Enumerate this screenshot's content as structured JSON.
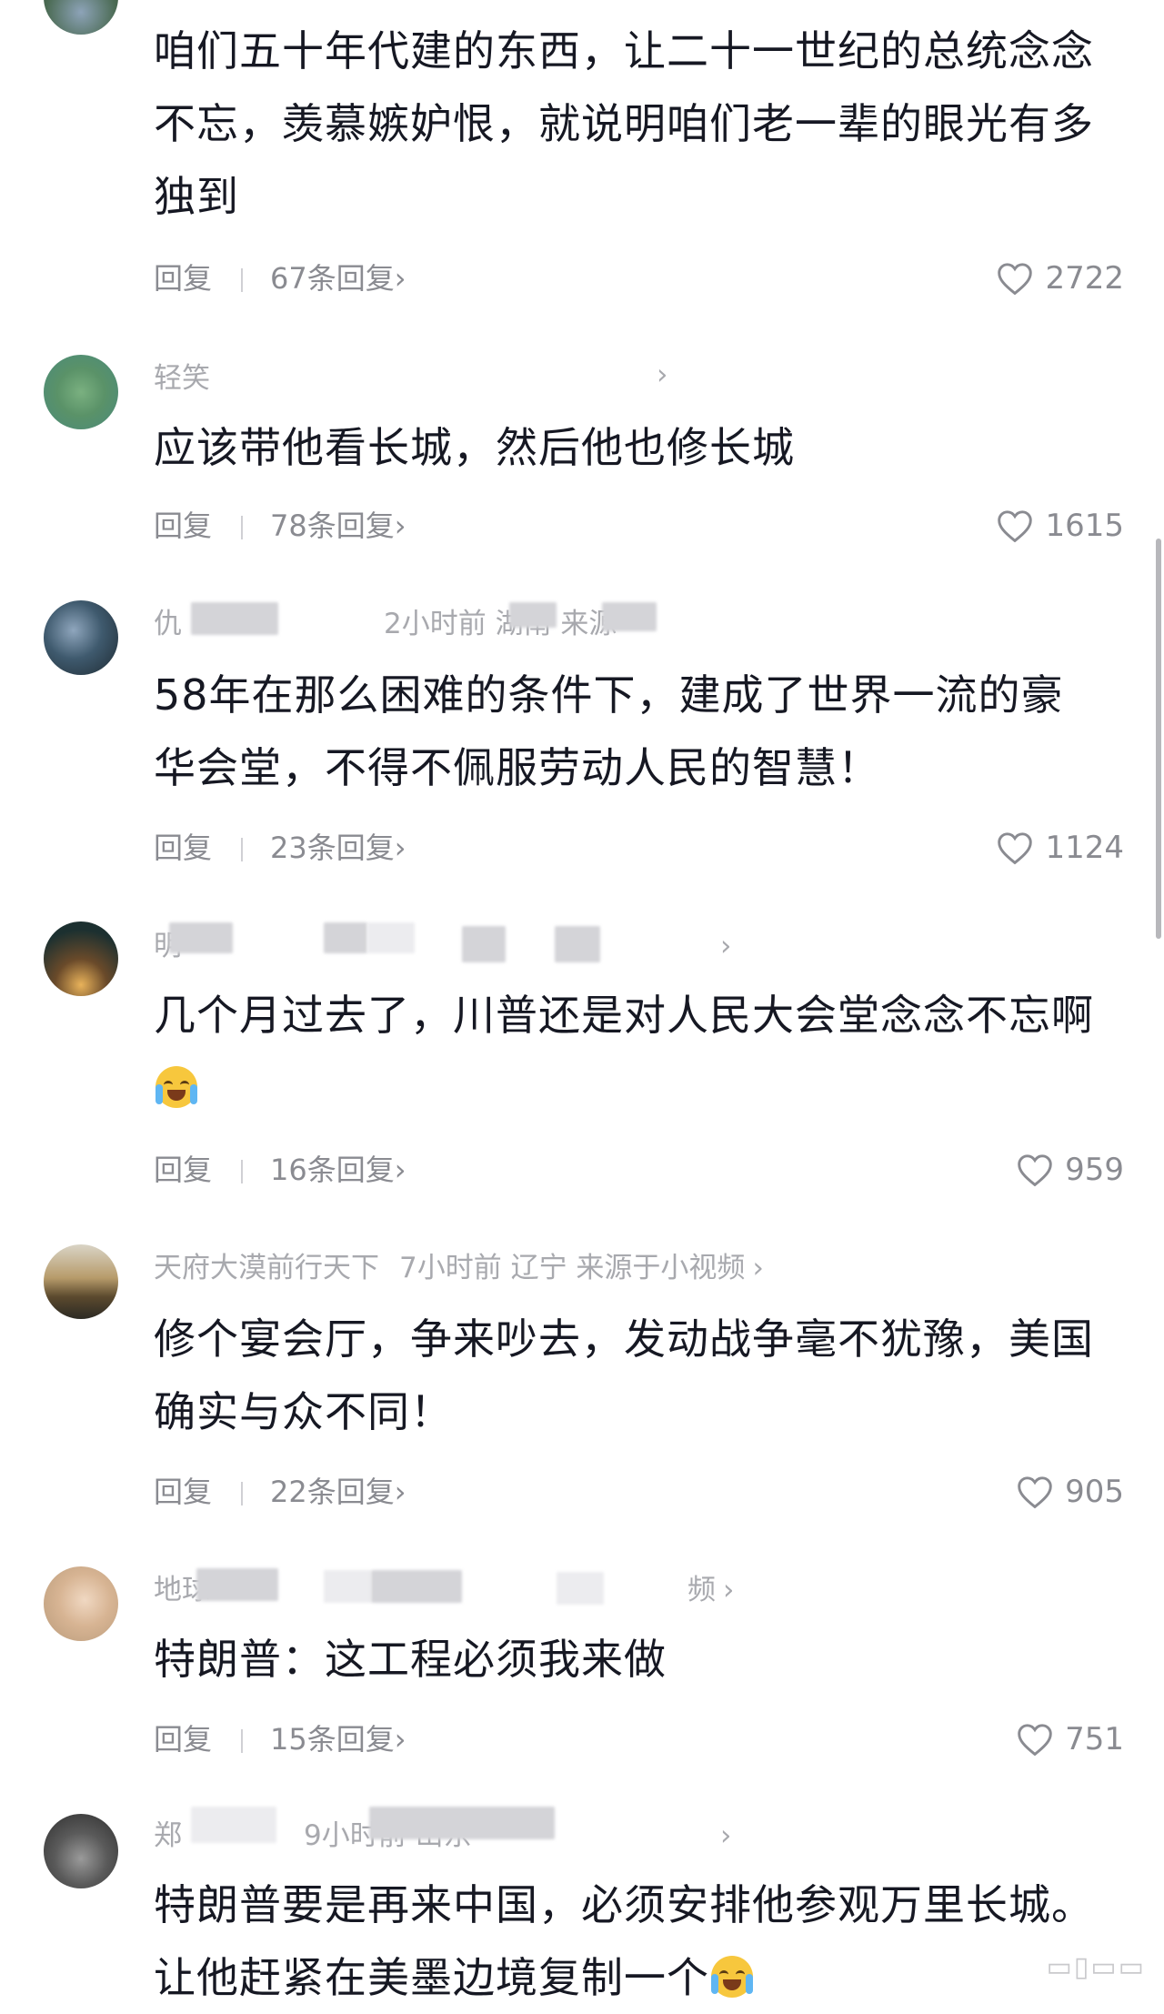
{
  "comments": [
    {
      "username": "",
      "meta": "",
      "text": "咱们五十年代建的东西，让二十一世纪的总统念念不忘，羡慕嫉妒恨，就说明咱们老一辈的眼光有多独到",
      "reply_label": "回复",
      "replies": "67条回复",
      "likes": "2722"
    },
    {
      "username": "轻笑",
      "meta": "",
      "text": "应该带他看长城，然后他也修长城",
      "reply_label": "回复",
      "replies": "78条回复",
      "likes": "1615"
    },
    {
      "username": "仇",
      "meta": "2小时前  湖南  来源",
      "text": "58年在那么困难的条件下，建成了世界一流的豪华会堂，不得不佩服劳动人民的智慧！",
      "reply_label": "回复",
      "replies": "23条回复",
      "likes": "1124"
    },
    {
      "username": "明",
      "meta": "",
      "text": "几个月过去了，川普还是对人民大会堂念念不忘啊",
      "reply_label": "回复",
      "replies": "16条回复",
      "likes": "959"
    },
    {
      "username": "天府大漠前行天下",
      "meta": "7小时前  辽宁  来源于小视频",
      "text": "修个宴会厅，争来吵去，发动战争毫不犹豫，美国确实与众不同！",
      "reply_label": "回复",
      "replies": "22条回复",
      "likes": "905"
    },
    {
      "username": "地球",
      "meta": "频",
      "text": "特朗普：这工程必须我来做",
      "reply_label": "回复",
      "replies": "15条回复",
      "likes": "751"
    },
    {
      "username": "郑",
      "meta": "9小时前  山东",
      "text": "特朗普要是再来中国，必须安排他参观万里长城。让他赶紧在美墨边境复制一个",
      "reply_label": "",
      "replies": "",
      "likes": ""
    }
  ],
  "icons": {
    "like": "heart-outline-icon",
    "chevron": "chevron-right-icon"
  }
}
